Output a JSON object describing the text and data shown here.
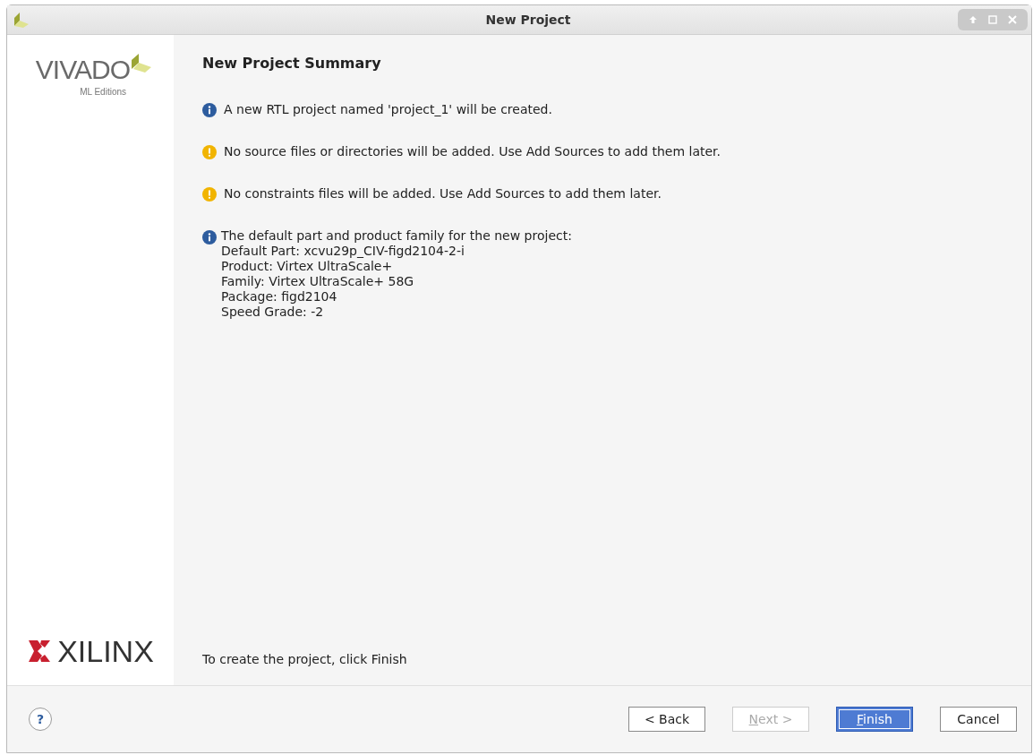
{
  "window": {
    "title": "New Project"
  },
  "sidebar": {
    "product_logo": {
      "name": "VIVADO",
      "subtitle": "ML Editions"
    },
    "company_logo": {
      "name": "XILINX"
    }
  },
  "page": {
    "heading": "New Project Summary",
    "messages": [
      {
        "kind": "info",
        "text": "A new RTL project named 'project_1' will be created."
      },
      {
        "kind": "warning",
        "text": "No source files or directories will be added. Use Add Sources to add them later."
      },
      {
        "kind": "warning",
        "text": "No constraints files will be added. Use Add Sources to add them later."
      },
      {
        "kind": "info",
        "text": "The default part and product family for the new project:",
        "details": [
          "Default Part: xcvu29p_CIV-figd2104-2-i",
          "Product: Virtex UltraScale+",
          "Family: Virtex UltraScale+ 58G",
          "Package: figd2104",
          "Speed Grade: -2"
        ]
      }
    ],
    "footer_note": "To create the project, click Finish"
  },
  "help_button": {
    "label": "?"
  },
  "buttons": [
    {
      "label": "< Back",
      "disabled": false,
      "default": false,
      "mnemonic": false
    },
    {
      "label": "Next >",
      "disabled": true,
      "default": false,
      "mnemonic": true
    },
    {
      "label": "Finish",
      "disabled": false,
      "default": true,
      "mnemonic": true
    },
    {
      "label": "Cancel",
      "disabled": false,
      "default": false,
      "mnemonic": false
    }
  ]
}
